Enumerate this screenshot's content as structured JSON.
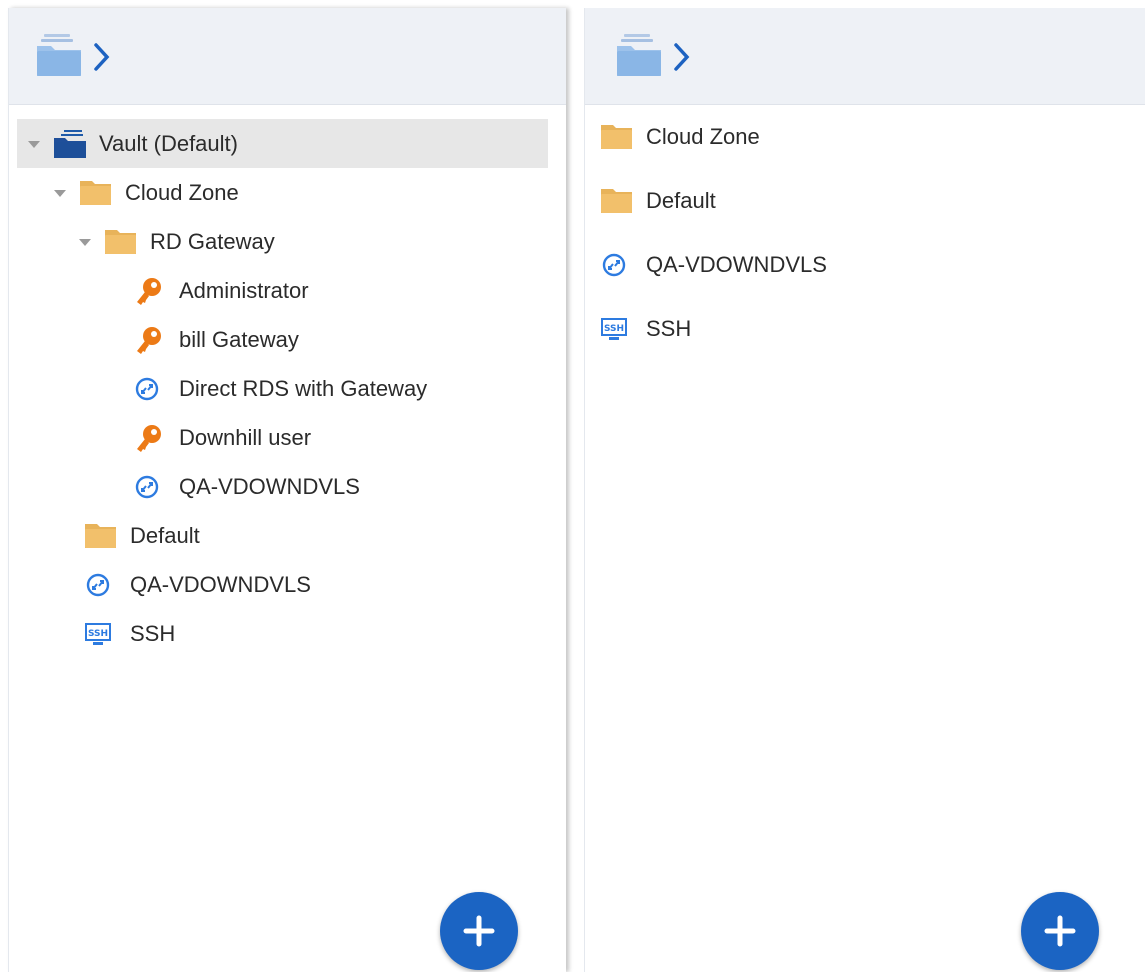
{
  "left_panel": {
    "tree": [
      {
        "label": "Vault (Default)",
        "icon": "vault-icon",
        "expanded": true,
        "selected": true
      },
      {
        "label": "Cloud Zone",
        "icon": "folder-icon",
        "expanded": true
      },
      {
        "label": "RD Gateway",
        "icon": "folder-icon",
        "expanded": true
      },
      {
        "label": "Administrator",
        "icon": "key-icon"
      },
      {
        "label": "bill Gateway",
        "icon": "key-icon"
      },
      {
        "label": "Direct RDS with Gateway",
        "icon": "rdp-icon"
      },
      {
        "label": "Downhill user",
        "icon": "key-icon"
      },
      {
        "label": "QA-VDOWNDVLS",
        "icon": "rdp-icon"
      },
      {
        "label": "Default",
        "icon": "folder-icon"
      },
      {
        "label": "QA-VDOWNDVLS",
        "icon": "rdp-icon"
      },
      {
        "label": "SSH",
        "icon": "ssh-icon"
      }
    ]
  },
  "right_panel": {
    "items": [
      {
        "label": "Cloud Zone",
        "icon": "folder-icon"
      },
      {
        "label": "Default",
        "icon": "folder-icon"
      },
      {
        "label": "QA-VDOWNDVLS",
        "icon": "rdp-icon"
      },
      {
        "label": "SSH",
        "icon": "ssh-icon"
      }
    ]
  },
  "colors": {
    "accent": "#1b64c3",
    "folder": "#f2c06b",
    "key": "#ec7a16",
    "rdp": "#2d7be0",
    "header_bg": "#eef1f6",
    "selected_bg": "#e7e7e7"
  }
}
